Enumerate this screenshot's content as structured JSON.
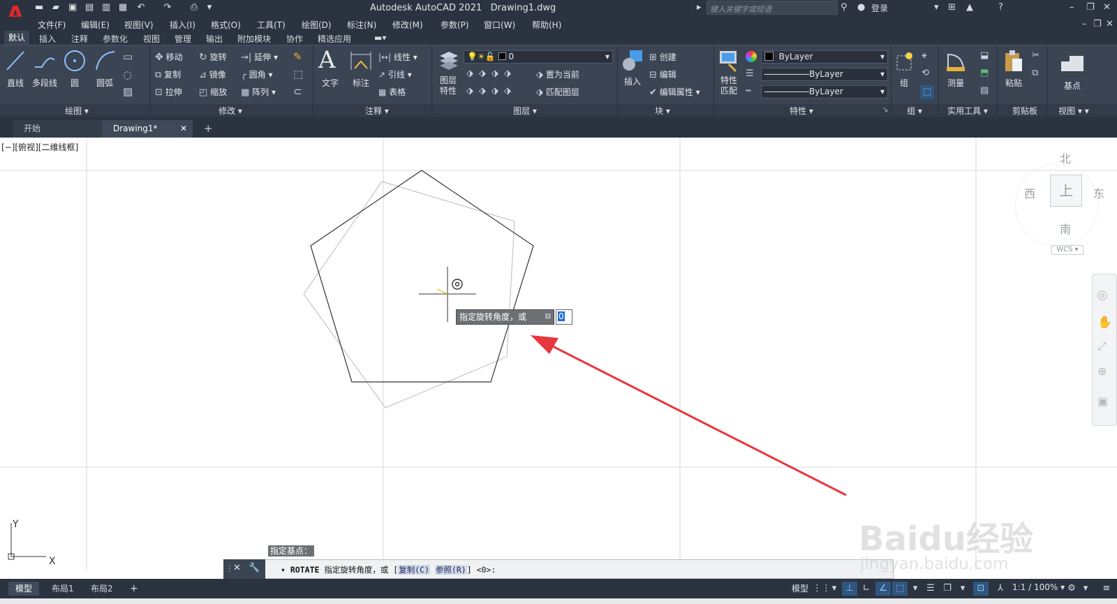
{
  "app": {
    "title": "Autodesk AutoCAD 2021",
    "file": "Drawing1.dwg",
    "logo": "A"
  },
  "search": {
    "placeholder": "键入关键字或短语"
  },
  "account": {
    "login": "登录"
  },
  "menus": [
    "文件(F)",
    "编辑(E)",
    "视图(V)",
    "插入(I)",
    "格式(O)",
    "工具(T)",
    "绘图(D)",
    "标注(N)",
    "修改(M)",
    "参数(P)",
    "窗口(W)",
    "帮助(H)"
  ],
  "ribbon_tabs": [
    "默认",
    "插入",
    "注释",
    "参数化",
    "视图",
    "管理",
    "输出",
    "附加模块",
    "协作",
    "精选应用"
  ],
  "panels": {
    "draw": {
      "title": "绘图",
      "line": "直线",
      "polyline": "多段线",
      "circle": "圆",
      "arc": "圆弧"
    },
    "modify": {
      "title": "修改",
      "move": "移动",
      "rotate": "旋转",
      "extend": "延伸",
      "copy": "复制",
      "mirror": "镜像",
      "fillet": "圆角",
      "stretch": "拉伸",
      "scale": "缩放",
      "array": "阵列"
    },
    "annotation": {
      "title": "注释",
      "text": "文字",
      "dimension": "标注",
      "linear": "线性",
      "leader": "引线",
      "table": "表格"
    },
    "layers": {
      "title": "图层",
      "layer_props": "图层\n特性",
      "layer_name": "0",
      "set_current": "置为当前",
      "match_layer": "匹配图层"
    },
    "block": {
      "title": "块",
      "insert": "插入",
      "create": "创建",
      "edit": "编辑",
      "edit_attr": "编辑属性"
    },
    "properties": {
      "title": "特性",
      "match": "特性\n匹配",
      "color": "ByLayer",
      "linetype": "ByLayer",
      "lineweight": "ByLayer"
    },
    "groups": {
      "title": "组",
      "group": "组"
    },
    "utilities": {
      "title": "实用工具",
      "measure": "测量"
    },
    "clipboard": {
      "title": "剪贴板",
      "paste": "粘贴"
    },
    "view": {
      "title": "视图",
      "base": "基点"
    }
  },
  "doc_tabs": {
    "start": "开始",
    "drawing": "Drawing1*"
  },
  "viewport": {
    "label": "[−][俯视][二维线框]"
  },
  "viewcube": {
    "north": "北",
    "south": "南",
    "east": "东",
    "west": "西",
    "top": "上",
    "wcs": "WCS"
  },
  "ucs": {
    "x": "X",
    "y": "Y"
  },
  "dynamic": {
    "prompt": "指定旋转角度，或",
    "input_value": "0",
    "base_point": "指定基点："
  },
  "command": {
    "cmd": "ROTATE",
    "text": "指定旋转角度，或 [",
    "opt1": "复制(C)",
    "opt2": "参照(R)",
    "tail": "] <0>:"
  },
  "layout_tabs": [
    "模型",
    "布局1",
    "布局2"
  ],
  "status": {
    "model": "模型",
    "scale": "1:1 / 100%"
  },
  "watermark": {
    "main": "Baidu经验",
    "sub": "jingyan.baidu.com"
  },
  "colors": {
    "accent_red": "#e8373d",
    "bg_dark": "#2b3340",
    "ribbon": "#3b4453"
  }
}
